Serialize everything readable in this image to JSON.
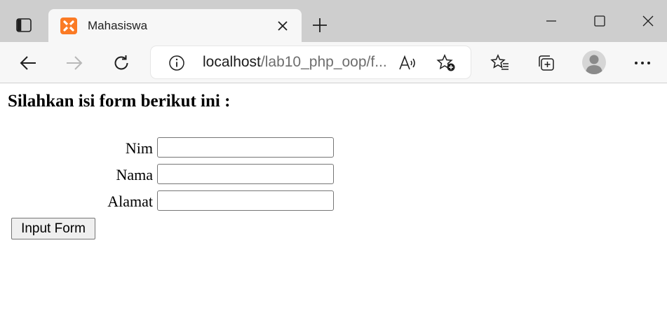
{
  "browser": {
    "tab": {
      "title": "Mahasiswa"
    },
    "address": {
      "host": "localhost",
      "path": "/lab10_php_oop/f..."
    }
  },
  "page": {
    "heading": "Silahkan isi form berikut ini :",
    "fields": [
      {
        "label": "Nim",
        "value": ""
      },
      {
        "label": "Nama",
        "value": ""
      },
      {
        "label": "Alamat",
        "value": ""
      }
    ],
    "submit_label": "Input Form"
  }
}
